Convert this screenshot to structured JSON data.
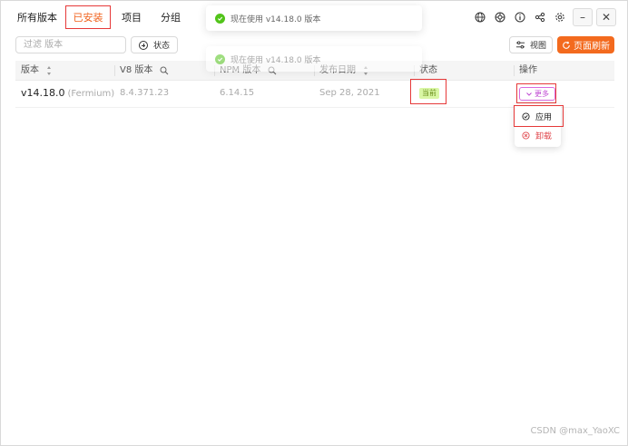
{
  "nav": {
    "tabs": [
      {
        "label": "所有版本"
      },
      {
        "label": "已安装"
      },
      {
        "label": "项目"
      },
      {
        "label": "分组"
      }
    ]
  },
  "toolbar": {
    "filter_placeholder": "过滤 版本",
    "status_label": "状态",
    "view_label": "视图",
    "refresh_label": "页面刷新"
  },
  "table": {
    "headers": {
      "version": "版本",
      "v8": "V8 版本",
      "npm": "NPM 版本",
      "date": "发布日期",
      "status": "状态",
      "actions": "操作"
    },
    "rows": [
      {
        "version": "v14.18.0",
        "codename": "(Fermium)",
        "v8": "8.4.371.23",
        "npm": "6.14.15",
        "date": "Sep 28, 2021",
        "status": "当前",
        "more": "更多"
      }
    ]
  },
  "dropdown": {
    "apply": "应用",
    "uninstall": "卸载"
  },
  "toasts": [
    {
      "message": "现在使用 v14.18.0 版本"
    },
    {
      "message": "现在使用 v14.18.0 版本"
    }
  ],
  "watermark": "CSDN @max_YaoXC",
  "colors": {
    "accent": "#f36a1e",
    "active_tab": "#f0621d",
    "highlight_box": "#e63939",
    "badge_bg": "#d9f7a5",
    "more_button": "#c04bd3",
    "danger": "#e0474c",
    "success": "#52c41a"
  }
}
